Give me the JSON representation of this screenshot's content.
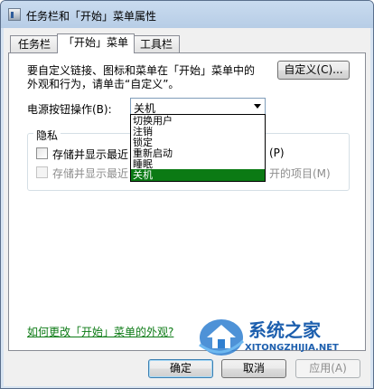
{
  "window": {
    "title": "任务栏和「开始」菜单属性"
  },
  "tabs": [
    {
      "label": "任务栏"
    },
    {
      "label": "「开始」菜单"
    },
    {
      "label": "工具栏"
    }
  ],
  "start_menu": {
    "description_line1": "要自定义链接、图标和菜单在「开始」菜单中的",
    "description_line2": "外观和行为，请单击“自定义”。",
    "customize_button": "自定义(C)...",
    "power_label": "电源按钮操作(B):",
    "power_selected": "关机",
    "power_options": [
      "切换用户",
      "注销",
      "锁定",
      "重新启动",
      "睡眠",
      "关机"
    ],
    "privacy_group_label": "隐私",
    "privacy_item1": "存储并显示最近",
    "privacy_item1_suffix": "(P)",
    "privacy_item2": "存储并显示最近",
    "privacy_item2_suffix": "开的项目(M)",
    "help_link": "如何更改「开始」菜单的外观?"
  },
  "footer": {
    "ok_button": "确定",
    "cancel_button": "取消",
    "apply_button": "应用(A)"
  },
  "watermark": {
    "cn_text": "系统之家",
    "url_text": "XITONGZHIJIA.NET"
  },
  "colors": {
    "title_bar": "#c4d7ed",
    "selection": "#0b7a14",
    "link": "#0b7a14"
  }
}
